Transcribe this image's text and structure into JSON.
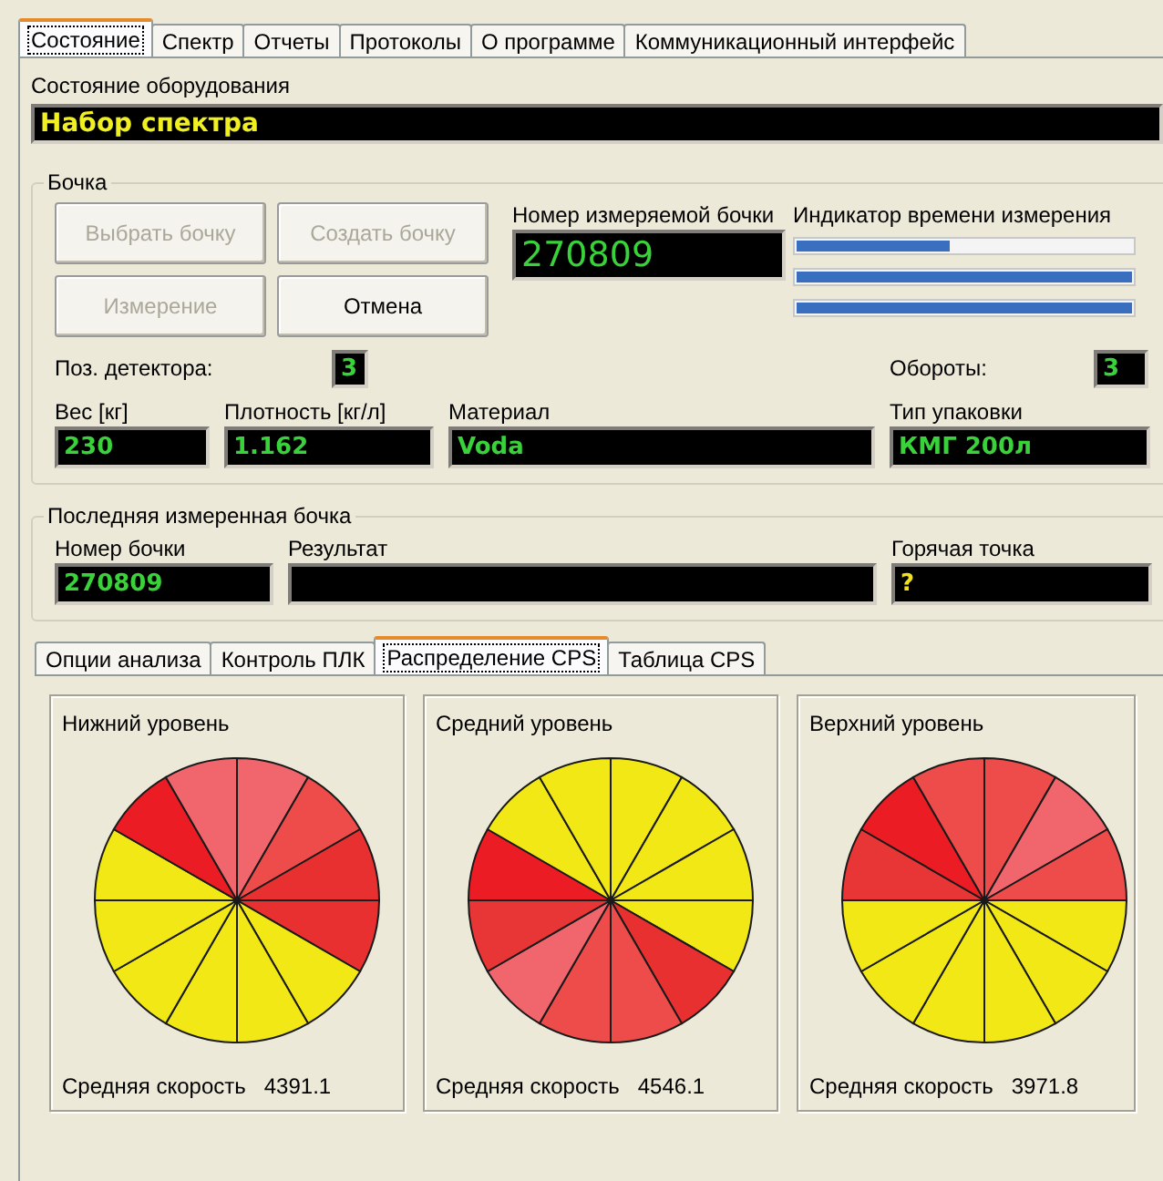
{
  "tabs": [
    {
      "label": "Состояние",
      "selected": true
    },
    {
      "label": "Спектр",
      "selected": false
    },
    {
      "label": "Отчеты",
      "selected": false
    },
    {
      "label": "Протоколы",
      "selected": false
    },
    {
      "label": "О программе",
      "selected": false
    },
    {
      "label": "Коммуникационный интерфейс",
      "selected": false
    }
  ],
  "equipment_status": {
    "label": "Состояние оборудования",
    "value": "Набор спектра"
  },
  "barrel": {
    "title": "Бочка",
    "buttons": [
      {
        "label": "Выбрать бочку",
        "disabled": true
      },
      {
        "label": "Создать бочку",
        "disabled": true
      },
      {
        "label": "Измерение",
        "disabled": true
      },
      {
        "label": "Отмена",
        "disabled": false
      }
    ],
    "barrel_number": {
      "label": "Номер измеряемой бочки",
      "value": "270809"
    },
    "time_indicator": {
      "label": "Индикатор времени измерения",
      "bars": [
        {
          "level": 0.46
        },
        {
          "level": 1
        },
        {
          "level": 1
        }
      ]
    },
    "detector_position": {
      "label": "Поз. детектора:",
      "value": "3"
    },
    "revolutions": {
      "label": "Обороты:",
      "value": "3"
    },
    "fields": [
      {
        "label": "Вес [кг]",
        "value": "230"
      },
      {
        "label": "Плотность [кг/л]",
        "value": "1.162"
      },
      {
        "label": "Материал",
        "value": "Voda"
      },
      {
        "label": "Тип упаковки",
        "value": "КМГ 200л"
      }
    ]
  },
  "last_barrel": {
    "title": "Последняя измеренная бочка",
    "fields": [
      {
        "label": "Номер бочки",
        "value": "270809",
        "color": "#3ad23a"
      },
      {
        "label": "Результат"
      },
      {
        "label": "Горячая точка",
        "value": "?",
        "color": "#f0e020"
      }
    ]
  },
  "sub_tabs": [
    {
      "label": "Опции анализа",
      "selected": false
    },
    {
      "label": "Контроль ПЛК",
      "selected": false
    },
    {
      "label": "Распределение CPS",
      "selected": true
    },
    {
      "label": "Таблица CPS",
      "selected": false
    }
  ],
  "levels": [
    {
      "title": "Нижний уровень",
      "reading_label": "Средняя скорость",
      "reading": "4391.1",
      "segments": [
        {
          "color": "#e83030"
        },
        {
          "color": "#f2e815"
        },
        {
          "color": "#f2e815"
        },
        {
          "color": "#f2e815"
        },
        {
          "color": "#f2e815"
        },
        {
          "color": "#f2e815"
        },
        {
          "color": "#f2e815"
        },
        {
          "color": "#ec1c24"
        },
        {
          "color": "#f0666c"
        },
        {
          "color": "#f0666c"
        },
        {
          "color": "#ee4b4b"
        },
        {
          "color": "#e83030"
        }
      ]
    },
    {
      "title": "Средний уровень",
      "reading_label": "Средняя скорость",
      "reading": "4546.1",
      "segments": [
        {
          "color": "#f2e815"
        },
        {
          "color": "#e83030"
        },
        {
          "color": "#ee4b4b"
        },
        {
          "color": "#ee4b4b"
        },
        {
          "color": "#f0666c"
        },
        {
          "color": "#e83535"
        },
        {
          "color": "#ec1c24"
        },
        {
          "color": "#f2e815"
        },
        {
          "color": "#f2e815"
        },
        {
          "color": "#f2e815"
        },
        {
          "color": "#f2e815"
        },
        {
          "color": "#f2e815"
        }
      ]
    },
    {
      "title": "Верхний уровень",
      "reading_label": "Средняя скорость",
      "reading": "3971.8",
      "segments": [
        {
          "color": "#f2e815"
        },
        {
          "color": "#f2e815"
        },
        {
          "color": "#f2e815"
        },
        {
          "color": "#f2e815"
        },
        {
          "color": "#f2e815"
        },
        {
          "color": "#f2e815"
        },
        {
          "color": "#e83535"
        },
        {
          "color": "#ec1c24"
        },
        {
          "color": "#ee4b4b"
        },
        {
          "color": "#ee4b4b"
        },
        {
          "color": "#f0666c"
        },
        {
          "color": "#ee4b4b"
        }
      ]
    }
  ]
}
